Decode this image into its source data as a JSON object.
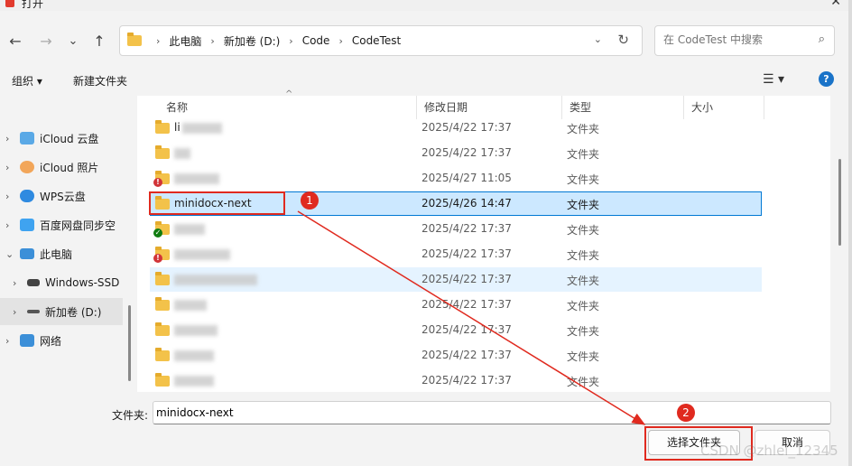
{
  "window": {
    "title": "打开",
    "close_glyph": "✕"
  },
  "nav": {
    "back": "←",
    "forward": "→",
    "recent": "⌄",
    "up": "↑",
    "breadcrumbs": [
      "此电脑",
      "新加卷 (D:)",
      "Code",
      "CodeTest"
    ],
    "sep": "›",
    "refresh": "↻",
    "dropdown": "⌄",
    "search_placeholder": "在 CodeTest 中搜索",
    "search_icon": "⌕"
  },
  "toolbar": {
    "organize": "组织 ▾",
    "new_folder": "新建文件夹",
    "view": "☰ ▾",
    "help": "?"
  },
  "sidebar": {
    "items": [
      {
        "label": "iCloud 云盘",
        "chev": "›",
        "color": "#5aa9e6"
      },
      {
        "label": "iCloud 照片",
        "chev": "›",
        "color": "#f2a65a"
      },
      {
        "label": "WPS云盘",
        "chev": "›",
        "color": "#2f8ae0"
      },
      {
        "label": "百度网盘同步空",
        "chev": "›",
        "color": "#3fa3f0"
      },
      {
        "label": "此电脑",
        "chev": "⌄",
        "color": "#3c8fd8"
      },
      {
        "label": "Windows-SSD",
        "chev": "›",
        "color": "#444444"
      },
      {
        "label": "新加卷 (D:)",
        "chev": "›",
        "color": "#555555"
      },
      {
        "label": "网络",
        "chev": "›",
        "color": "#3c8fd8"
      }
    ]
  },
  "columns": {
    "name": "名称",
    "modified": "修改日期",
    "type": "类型",
    "size": "大小",
    "sort_glyph": "^"
  },
  "files": [
    {
      "name": "li",
      "date": "2025/4/22 17:37",
      "type": "文件夹"
    },
    {
      "name": "",
      "date": "2025/4/22 17:37",
      "type": "文件夹"
    },
    {
      "name": "",
      "date": "2025/4/27 11:05",
      "type": "文件夹"
    },
    {
      "name": "minidocx-next",
      "date": "2025/4/26 14:47",
      "type": "文件夹"
    },
    {
      "name": "",
      "date": "2025/4/22 17:37",
      "type": "文件夹"
    },
    {
      "name": "",
      "date": "2025/4/22 17:37",
      "type": "文件夹"
    },
    {
      "name": "",
      "date": "2025/4/22 17:37",
      "type": "文件夹"
    },
    {
      "name": "",
      "date": "2025/4/22 17:37",
      "type": "文件夹"
    },
    {
      "name": "",
      "date": "2025/4/22 17:37",
      "type": "文件夹"
    },
    {
      "name": "",
      "date": "2025/4/22 17:37",
      "type": "文件夹"
    },
    {
      "name": "",
      "date": "2025/4/22 17:37",
      "type": "文件夹"
    }
  ],
  "badges": {
    "error": "!",
    "ok": "✓"
  },
  "footer": {
    "folder_label": "文件夹:",
    "folder_value": "minidocx-next",
    "select_button": "选择文件夹",
    "cancel_button": "取消"
  },
  "annotations": {
    "step1": "1",
    "step2": "2",
    "color": "#e02a1f"
  },
  "watermark": "CSDN @zhlei_12345"
}
